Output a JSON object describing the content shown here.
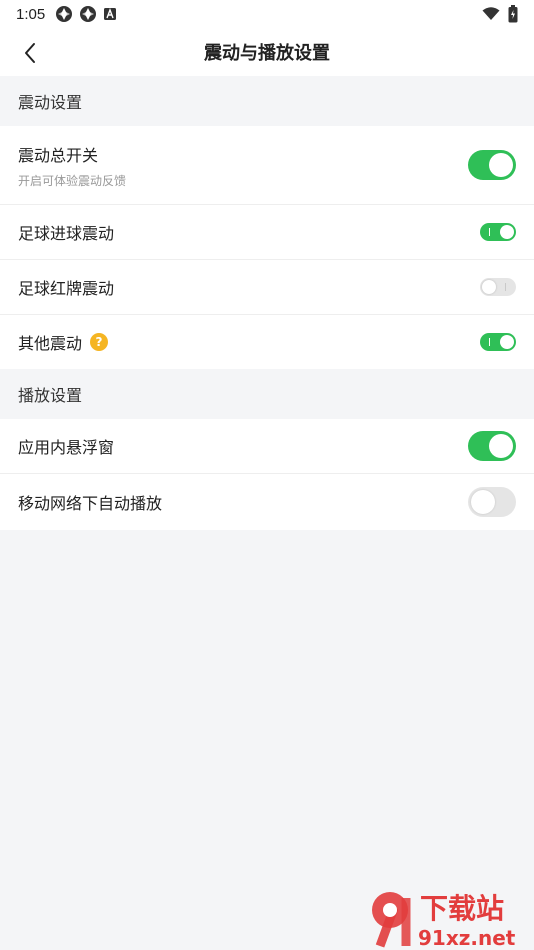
{
  "status_bar": {
    "time": "1:05",
    "icons": [
      "app-icon",
      "app-icon",
      "font-icon",
      "wifi-icon",
      "battery-icon"
    ]
  },
  "header": {
    "title": "震动与播放设置"
  },
  "sections": [
    {
      "title": "震动设置",
      "items": [
        {
          "label": "震动总开关",
          "subtitle": "开启可体验震动反馈",
          "enabled": true
        },
        {
          "label": "足球进球震动",
          "enabled": true
        },
        {
          "label": "足球红牌震动",
          "enabled": false
        },
        {
          "label": "其他震动",
          "enabled": true,
          "has_help": true,
          "help_glyph": "?"
        }
      ]
    },
    {
      "title": "播放设置",
      "items": [
        {
          "label": "应用内悬浮窗",
          "enabled": true
        },
        {
          "label": "移动网络下自动播放",
          "enabled": false
        }
      ]
    }
  ],
  "watermark": {
    "text_top": "下载站",
    "text_bottom": "91xz.net"
  },
  "colors": {
    "accent": "#2fbf57",
    "toggle_off": "#e5e5e5",
    "help": "#f5b523",
    "background": "#f4f5f7"
  }
}
